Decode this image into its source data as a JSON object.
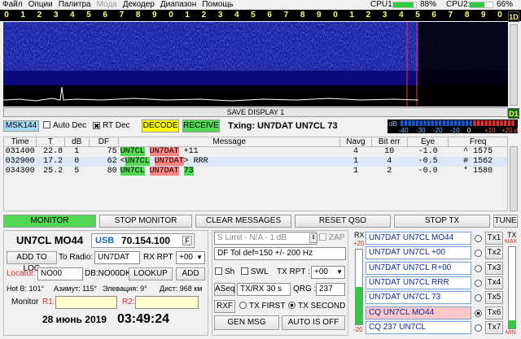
{
  "menu": {
    "items": [
      "Файл",
      "Опции",
      "Палитра",
      "Мода",
      "Декодер",
      "Диапазон",
      "Помощь"
    ]
  },
  "cpu": {
    "cpu1_label": "CPU1:",
    "cpu1_value": "88%",
    "cpu1_level": 0.88,
    "cpu2_label": "CPU2:",
    "cpu2_value": "66%",
    "cpu2_level": 0.66
  },
  "scale": {
    "ticks": [
      "0",
      "1",
      "2",
      "3",
      "4",
      "5",
      "6",
      "7",
      "8",
      "9",
      "0",
      "1",
      "2",
      "3",
      "4",
      "5",
      "6",
      "7",
      "8",
      "9",
      "0",
      "1",
      "2",
      "3",
      "4",
      "5",
      "6",
      "7",
      "8",
      "9",
      "0"
    ]
  },
  "waterfall": {
    "save_label": "SAVE DISPLAY 1"
  },
  "side": {
    "btn1": "1D",
    "btn2": "D1"
  },
  "controls": {
    "mode": "MSK144",
    "auto_dec": "Auto Dec",
    "rt_dec": "RT Dec",
    "decode": "DECODE",
    "receive": "RECEIVE",
    "txing": "Txing: UN7DAT UN7CL 73",
    "meter_label": "dB",
    "meter_ticks": [
      "-40",
      "-30",
      "-20",
      "-10",
      "0",
      "+10",
      "+20 dB"
    ]
  },
  "table": {
    "headers": [
      "Time",
      "T",
      "dB",
      "DF",
      "Message",
      "Navg",
      "Bit err",
      "Eye",
      "Freq"
    ],
    "rows": [
      {
        "time": "031400",
        "t": "22.8",
        "db": "1",
        "df": "75",
        "msg": [
          [
            "UN7CL",
            "g"
          ],
          [
            " ",
            ""
          ],
          [
            "UN7DAT",
            "r"
          ],
          [
            " +11",
            ""
          ]
        ],
        "navg": "4",
        "biterr": "10",
        "eye": "-1.0",
        "freq": "^ 1575"
      },
      {
        "time": "032900",
        "t": "17.2",
        "db": "0",
        "df": "62",
        "msg": [
          [
            "<",
            ""
          ],
          [
            "UN7CL",
            "g"
          ],
          [
            " ",
            ""
          ],
          [
            "UN7DAT",
            "r"
          ],
          [
            "> RRR",
            ""
          ]
        ],
        "navg": "1",
        "biterr": "4",
        "eye": "-0.5",
        "freq": "# 1562"
      },
      {
        "time": "034300",
        "t": "25.2",
        "db": "5",
        "df": "80",
        "msg": [
          [
            "UN7CL",
            "g"
          ],
          [
            " ",
            ""
          ],
          [
            "UN7DAT",
            "r"
          ],
          [
            " ",
            ""
          ],
          [
            "73",
            "g"
          ]
        ],
        "navg": "1",
        "biterr": "2",
        "eye": "-0.0",
        "freq": "* 1580"
      }
    ]
  },
  "tabs": [
    "MONITOR",
    "STOP MONITOR",
    "CLEAR MESSAGES",
    "RESET QSO",
    "STOP TX",
    "TUNE"
  ],
  "station": {
    "title": "UN7CL MO44",
    "band": "USB",
    "freq": "70.154.100",
    "f_btn": "F",
    "add_log": "ADD TO LOG",
    "to_radio": "To Radio:",
    "radio_call": "UN7DAT",
    "rx_rpt": "RX RPT :",
    "rx_rpt_val": "+00",
    "locator_label": "Locator:",
    "locator": "NO00",
    "db_text": "DB:NO00DK",
    "lookup": "LOOKUP",
    "add": "ADD",
    "hotb": "Hot B: 101°",
    "azim": "Азимут: 115°",
    "elev": "Элевация: 9°",
    "dist": "Дист: 968 км",
    "monitor": "Monitor",
    "r1": "R1:",
    "r2": "R2:",
    "date": "28 июнь 2019",
    "time": "03:49:24"
  },
  "txcfg": {
    "slimit": "S Limit - N/A - 1  dB",
    "zap": "ZAP",
    "dftol": "DF Tol def=150 +/-  200  Hz",
    "sh": "Sh",
    "swl": "SWL",
    "tx_rpt": "TX RPT :",
    "tx_rpt_val": "+00",
    "aseq": "ASeq",
    "txrx": "TX/RX 30  s",
    "qrg": "QRG :",
    "qrg_val": "237",
    "rxf": "RXF",
    "tx_first": "TX FIRST",
    "tx_second": "TX SECOND",
    "gen_msg": "GEN MSG",
    "auto": "AUTO IS OFF"
  },
  "levels": {
    "rx": "RX",
    "rx_top": "+20",
    "rx_bottom": "-20",
    "tx": "TX",
    "tx_top": "MAX",
    "tx_bottom": "MIN",
    "rx_level": 0.5,
    "tx_level": 0.1
  },
  "tx_msgs": [
    {
      "text": "UN7DAT UN7CL MO44",
      "btn": "Tx1"
    },
    {
      "text": "UN7DAT UN7CL +00",
      "btn": "Tx2"
    },
    {
      "text": "UN7DAT UN7CL R+00",
      "btn": "Tx3"
    },
    {
      "text": "UN7DAT UN7CL RRR",
      "btn": "Tx4"
    },
    {
      "text": "UN7DAT UN7CL 73",
      "btn": "Tx5"
    },
    {
      "text": "CQ UN7CL MO44",
      "btn": "Tx6"
    },
    {
      "text": "CQ 237 UN7CL",
      "btn": "Tx7"
    }
  ],
  "colors": {
    "green": "#52d852",
    "red": "#ff8585",
    "yellow": "#ffff00",
    "waterfall": "#0a0a6e",
    "accent": "#0a2a9a"
  }
}
